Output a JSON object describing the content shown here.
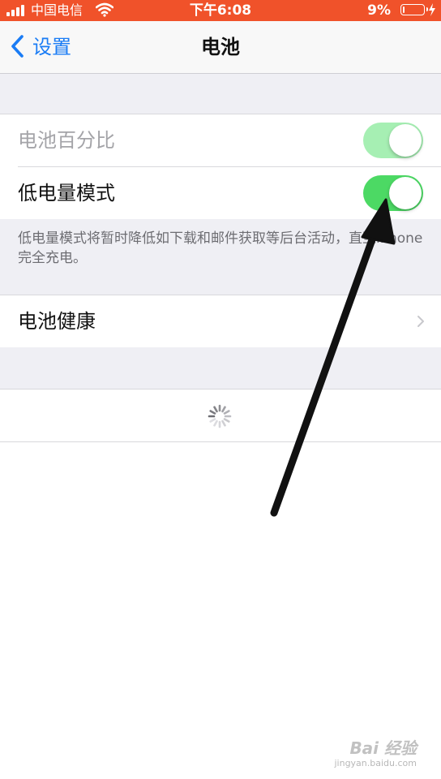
{
  "status_bar": {
    "carrier": "中国电信",
    "time": "下午6:08",
    "battery_percent": "9%",
    "battery_level": 0.09,
    "background": "#f0522a"
  },
  "nav": {
    "back_label": "设置",
    "title": "电池",
    "back_icon": "chevron-left-icon",
    "accent": "#1a7cf5"
  },
  "settings": {
    "battery_percentage": {
      "label": "电池百分比",
      "enabled": false,
      "on": true
    },
    "low_power_mode": {
      "label": "低电量模式",
      "enabled": true,
      "on": true
    },
    "low_power_footnote": "低电量模式将暂时降低如下载和邮件获取等后台活动，直至iPhone 完全充电。",
    "battery_health": {
      "label": "电池健康",
      "icon": "chevron-right-icon"
    }
  },
  "colors": {
    "switch_on": "#4cd964",
    "switch_on_disabled": "#a6efb3",
    "annotation_arrow": "#111111"
  },
  "watermark": {
    "main": "Bai 经验",
    "sub": "jingyan.baidu.com"
  }
}
